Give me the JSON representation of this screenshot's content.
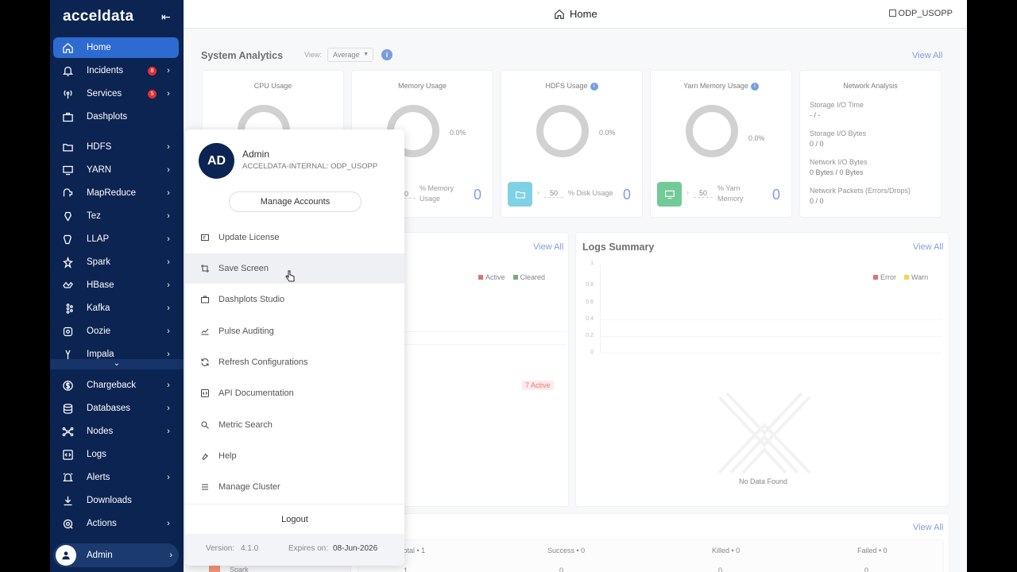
{
  "brand": {
    "name": "acceldata"
  },
  "sidebar": {
    "items": [
      {
        "label": "Home",
        "icon": "home-icon",
        "active": true
      },
      {
        "label": "Incidents",
        "icon": "bell-icon",
        "badge": "8",
        "chevron": "›"
      },
      {
        "label": "Services",
        "icon": "broadcast-icon",
        "badge": "5",
        "chevron": "›"
      },
      {
        "label": "Dashplots",
        "icon": "briefcase-icon"
      },
      {
        "label": "HDFS",
        "icon": "folder-icon",
        "chevron": "›"
      },
      {
        "label": "YARN",
        "icon": "monitor-icon",
        "chevron": "›"
      },
      {
        "label": "MapReduce",
        "icon": "elephant-icon",
        "chevron": "›"
      },
      {
        "label": "Tez",
        "icon": "tez-icon",
        "chevron": "›"
      },
      {
        "label": "LLAP",
        "icon": "llap-icon",
        "chevron": "›"
      },
      {
        "label": "Spark",
        "icon": "spark-icon",
        "chevron": "›"
      },
      {
        "label": "HBase",
        "icon": "hbase-icon",
        "chevron": "›"
      },
      {
        "label": "Kafka",
        "icon": "kafka-icon",
        "chevron": "›"
      },
      {
        "label": "Oozie",
        "icon": "oozie-icon",
        "chevron": "›"
      },
      {
        "label": "Impala",
        "icon": "impala-icon",
        "chevron": "›"
      },
      {
        "label": "Chargeback",
        "icon": "dollar-icon",
        "chevron": "›"
      },
      {
        "label": "Databases",
        "icon": "database-icon",
        "chevron": "›"
      },
      {
        "label": "Nodes",
        "icon": "nodes-icon",
        "chevron": "›"
      },
      {
        "label": "Logs",
        "icon": "code-icon"
      },
      {
        "label": "Alerts",
        "icon": "alert-bell-icon",
        "chevron": "›"
      },
      {
        "label": "Downloads",
        "icon": "download-icon"
      },
      {
        "label": "Actions",
        "icon": "actions-icon",
        "chevron": "›"
      }
    ],
    "scroll_glyph": "⌄",
    "admin_label": "Admin",
    "admin_chevron": "›",
    "collapse_glyph": "⇤"
  },
  "topbar": {
    "title": "Home",
    "cluster": "ODP_USOPP"
  },
  "system_analytics": {
    "title": "System Analytics",
    "view_label": "View:",
    "view_value": "Average",
    "view_all": "View All",
    "cpu": {
      "title": "CPU Usage"
    },
    "memory": {
      "title": "Memory Usage",
      "pct": "0.0%",
      "threshold": "0",
      "unit_label": "% Memory Usage",
      "value": "0"
    },
    "hdfs": {
      "title": "HDFS Usage",
      "pct": "0.0%",
      "threshold": "50",
      "unit_label": "% Disk Usage",
      "value": "0",
      "tile_color": "#3bb8d8"
    },
    "yarn": {
      "title": "Yarn Memory Usage",
      "pct": "0.0%",
      "threshold": "50",
      "unit_label": "% Yarn Memory",
      "value": "0",
      "tile_color": "#27ae60"
    },
    "network": {
      "title": "Network Analysis",
      "rows": [
        {
          "label": "Storage I/O Time",
          "value": "- / -"
        },
        {
          "label": "Storage I/O Bytes",
          "value": "0 / 0"
        },
        {
          "label": "Network I/O Bytes",
          "value": "0 Bytes / 0 Bytes"
        },
        {
          "label": "Network Packets (Errors/Drops)",
          "value": "0 / 0"
        }
      ]
    }
  },
  "incidents_panel": {
    "view_all": "View All",
    "legend": [
      {
        "label": "Active",
        "color": "#c62828"
      },
      {
        "label": "Cleared",
        "color": "#2e7d32"
      }
    ],
    "active_badge": "7 Active"
  },
  "logs_summary": {
    "title": "Logs Summary",
    "view_all": "View All",
    "legend": [
      {
        "label": "Error",
        "color": "#c62828"
      },
      {
        "label": "Warn",
        "color": "#f5b800"
      }
    ],
    "y_ticks": [
      "1",
      "0.8",
      "0.6",
      "0.4",
      "0.2",
      "0"
    ],
    "empty_text": "No Data Found"
  },
  "jobs": {
    "view_all": "View All",
    "headers": [
      "Total • 1",
      "Success • 0",
      "Killed • 0",
      "Failed • 0"
    ],
    "row": {
      "name": "Spark",
      "values": [
        "1",
        "0",
        "0",
        "0"
      ]
    }
  },
  "menu": {
    "avatar": "AD",
    "name": "Admin",
    "org": "ACCELDATA-INTERNAL: ODP_USOPP",
    "manage_accounts": "Manage Accounts",
    "items": [
      {
        "label": "Update License",
        "icon": "license-icon"
      },
      {
        "label": "Save Screen",
        "icon": "crop-icon"
      },
      {
        "label": "Dashplots Studio",
        "icon": "briefcase-icon"
      },
      {
        "label": "Pulse Auditing",
        "icon": "chart-line-icon"
      },
      {
        "label": "Refresh Configurations",
        "icon": "refresh-icon"
      },
      {
        "label": "API Documentation",
        "icon": "code-icon"
      },
      {
        "label": "Metric Search",
        "icon": "search-icon"
      },
      {
        "label": "Help",
        "icon": "wrench-icon"
      },
      {
        "label": "Manage Cluster",
        "icon": "list-icon"
      }
    ],
    "logout": "Logout",
    "version_label": "Version:",
    "version": "4.1.0",
    "expires_label": "Expires on:",
    "expires": "08-Jun-2026"
  }
}
